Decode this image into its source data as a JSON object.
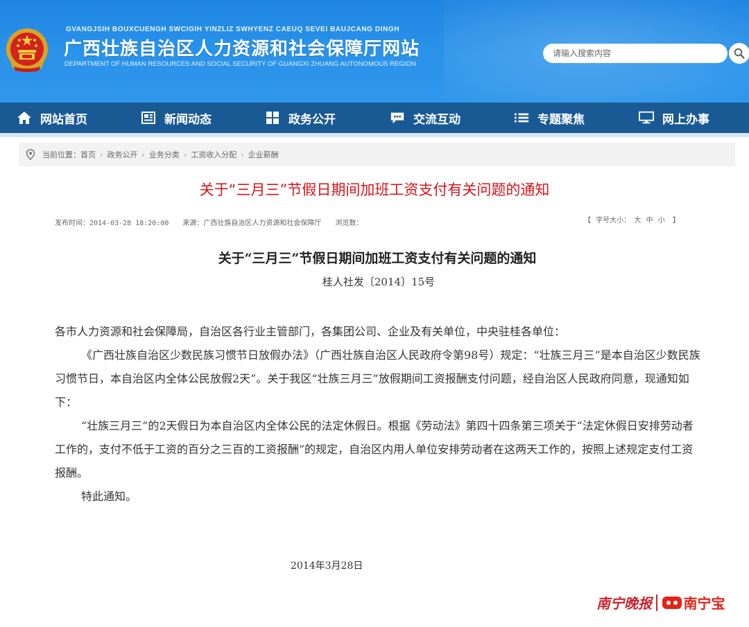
{
  "header": {
    "pinyin": "GVANGJSIH BOUXCUENGH SWCIGIH YINZLIZ SWHYENZ CAEUQ SEVEI BAUJCANG DINGH",
    "title": "广西壮族自治区人力资源和社会保障厅网站",
    "english": "DEPARTMENT OF HUMAN RESOURCES AND SOCIAL SECURITY OF GUANGXI ZHUANG AUTONOMOUS REGION",
    "emblem_icon": "national-emblem-icon",
    "search": {
      "placeholder": "请输入搜索内容",
      "icon": "search-icon"
    }
  },
  "nav": {
    "items": [
      {
        "label": "网站首页",
        "icon": "home-icon"
      },
      {
        "label": "新闻动态",
        "icon": "newspaper-icon"
      },
      {
        "label": "政务公开",
        "icon": "grid-icon"
      },
      {
        "label": "交流互动",
        "icon": "chat-icon"
      },
      {
        "label": "专题聚焦",
        "icon": "list-icon"
      },
      {
        "label": "网上办事",
        "icon": "monitor-icon"
      }
    ],
    "bg_color": "#1a5a94"
  },
  "breadcrumb": {
    "icon": "location-pin-icon",
    "prefix": "当前位置：",
    "items": [
      "首页",
      "政务公开",
      "业务分类",
      "工资收入分配",
      "企业薪酬"
    ],
    "separator": "›"
  },
  "article": {
    "title": "关于“三月三”节假日期间加班工资支付有关问题的通知",
    "title_color": "#d8141a",
    "publish_time": "发布时间：2014-03-28 18:20:00",
    "source": "来源：广西壮族自治区人力资源和社会保障厅",
    "views": "浏览数：",
    "font_size": {
      "open": "【",
      "label": "字号大小：",
      "large": "大",
      "medium": "中",
      "small": "小",
      "close": "】"
    }
  },
  "document": {
    "title": "关于“三月三”节假日期间加班工资支付有关问题的通知",
    "number": "桂人社发〔2014〕15号",
    "addressee": "各市人力资源和社会保障局，自治区各行业主管部门，各集团公司、企业及有关单位，中央驻桂各单位：",
    "para1": "《广西壮族自治区少数民族习惯节日放假办法》（广西壮族自治区人民政府令第98号）规定：“壮族三月三”是本自治区少数民族习惯节日，本自治区内全体公民放假2天”。关于我区“壮族三月三”放假期间工资报酬支付问题，经自治区人民政府同意，现通知如下：",
    "para2": "“壮族三月三”的2天假日为本自治区内全体公民的法定休假日。根据《劳动法》第四十四条第三项关于“法定休假日安排劳动者工作的，支付不低于工资的百分之三百的工资报酬”的规定，自治区内用人单位安排劳动者在这两天工作的，按照上述规定支付工资报酬。",
    "closing": "特此通知。",
    "date": "2014年3月28日"
  },
  "watermark": {
    "left": "南宁晚报",
    "right": "南宁宝",
    "logo_icon": "nanningbao-logo-icon",
    "color": "#c8262d"
  }
}
